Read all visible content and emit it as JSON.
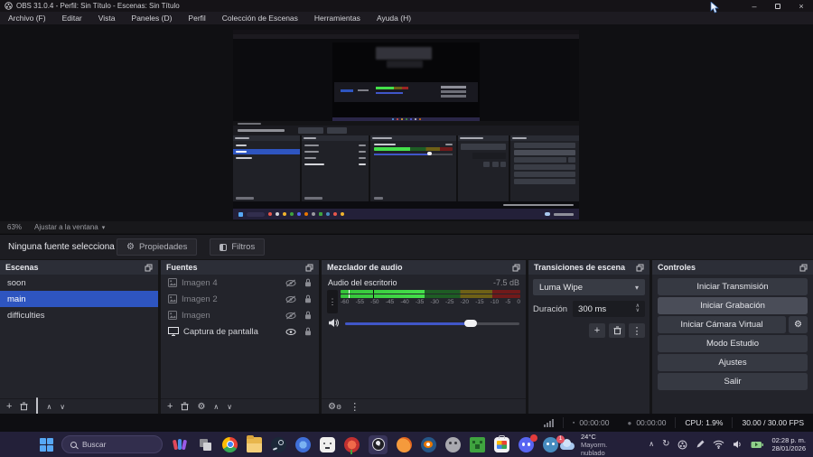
{
  "window": {
    "title": "OBS 31.0.4 - Perfil: Sin Título - Escenas: Sin Título",
    "minimize": "–",
    "close": "×"
  },
  "menu": {
    "items": [
      "Archivo (F)",
      "Editar",
      "Vista",
      "Paneles (D)",
      "Perfil",
      "Colección de Escenas",
      "Herramientas",
      "Ayuda (H)"
    ]
  },
  "preview": {
    "zoom": "63%",
    "fit": "Ajustar a la ventana",
    "caret": "▾"
  },
  "source_toolbar": {
    "status": "Ninguna fuente selecciona",
    "properties": "Propiedades",
    "filters": "Filtros"
  },
  "scenes": {
    "title": "Escenas",
    "items": [
      "soon",
      "main",
      "difficulties"
    ],
    "selected": "main"
  },
  "sources": {
    "title": "Fuentes",
    "items": [
      {
        "name": "Imagen 4",
        "type": "image-icon",
        "visible": false
      },
      {
        "name": "Imagen 2",
        "type": "image-icon",
        "visible": false
      },
      {
        "name": "Imagen",
        "type": "image-icon",
        "visible": false
      },
      {
        "name": "Captura de pantalla",
        "type": "display-icon",
        "visible": true
      }
    ]
  },
  "mixer": {
    "title": "Mezclador de audio",
    "source_name": "Audio del escritorio",
    "level_db": "-7.5 dB",
    "ticks": [
      "-60",
      "-55",
      "-50",
      "-45",
      "-40",
      "-35",
      "-30",
      "-25",
      "-20",
      "-15",
      "-10",
      "-5",
      "0"
    ],
    "meter": {
      "bright_pct": 46.5,
      "green_end_pct": 66.5,
      "yellow_end_pct": 84.5,
      "bright_color": "#44e04a",
      "dim_green": "#1e5c24",
      "dim_yellow": "#6e6016",
      "dim_red": "#701a1a",
      "white_peak_pct": 4.5,
      "dark_peak_pct": 18
    },
    "volume_pct": 72,
    "kebab": "⋮"
  },
  "transitions": {
    "title": "Transiciones de escena",
    "current": "Luma Wipe",
    "duration_label": "Duración",
    "duration_value": "300 ms",
    "add": "+",
    "kebab": "⋮",
    "caret": "▾"
  },
  "controls": {
    "title": "Controles",
    "buttons": [
      "Iniciar Transmisión",
      "Iniciar Grabación",
      "Iniciar Cámara Virtual",
      "Modo Estudio",
      "Ajustes",
      "Salir"
    ],
    "gear": "⚙"
  },
  "status_bar": {
    "stream_bullet": "▪",
    "stream_time": "00:00:00",
    "record_bullet": "●",
    "record_time": "00:00:00",
    "cpu": "CPU: 1.9%",
    "fps": "30.00 / 30.00 FPS"
  },
  "taskbar": {
    "search_placeholder": "Buscar",
    "icons": [
      "start",
      "search",
      "widgets",
      "task-view",
      "chrome",
      "file-explorer",
      "steam",
      "photos",
      "character-app",
      "fireworks-app",
      "obs",
      "fl-studio",
      "blender",
      "gimp",
      "minecraft",
      "store",
      "discord",
      "godot"
    ],
    "weather": {
      "badge": "1",
      "temp": "24°C",
      "condition": "Mayorm. nublado"
    },
    "tray_chevron": "∧",
    "tray_sync": "↻",
    "clock": {
      "time": "02:28 p. m.",
      "date": "28/01/2026"
    }
  },
  "colors": {
    "selection_blue": "#2e55c0",
    "volume_blue": "#4056c8",
    "taskbar_bg": "#232039",
    "obs_underline": "#6cb4ee"
  }
}
